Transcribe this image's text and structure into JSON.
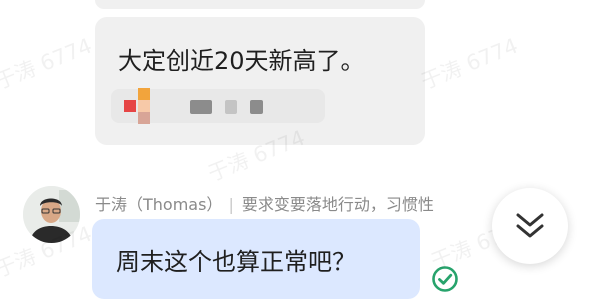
{
  "watermark": {
    "text": "于涛 6774"
  },
  "messages": [
    {
      "text": "大定创近20天新高了。",
      "link_card": {
        "content_visible": false
      }
    },
    {
      "sender_name": "于涛（Thomas）",
      "sender_signature": "要求变要落地行动，习惯性",
      "text": "周末这个也算正常吧？",
      "status": {
        "icon": "read-check-icon",
        "color": "#27a36c"
      }
    }
  ],
  "scroll_to_bottom": {
    "icon": "double-chevron-down-icon"
  },
  "colors": {
    "incoming_bubble": "#f0f0f0",
    "outgoing_bubble": "#dce8ff",
    "read_check": "#27a36c"
  }
}
